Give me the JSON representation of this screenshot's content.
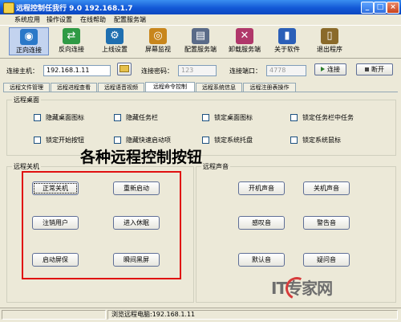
{
  "window": {
    "title": "远程控制任我行 9.0  192.168.1.7",
    "buttons": [
      "_",
      "□",
      "×"
    ]
  },
  "menu": [
    "系统应用",
    "操作设置",
    "在线帮助",
    "配置服务端"
  ],
  "toolbar": [
    {
      "label": "正向连接",
      "icon": "globe-connect-icon",
      "color": "#2a78c8",
      "glyph": "◉",
      "active": true
    },
    {
      "label": "反向连接",
      "icon": "reverse-connect-icon",
      "color": "#2f9a45",
      "glyph": "⇄"
    },
    {
      "label": "上线设置",
      "icon": "settings-globe-icon",
      "color": "#1f6fb0",
      "glyph": "⚙"
    },
    {
      "label": "屏幕监视",
      "icon": "eye-monitor-icon",
      "color": "#c8861c",
      "glyph": "◎"
    },
    {
      "label": "配置服务端",
      "icon": "server-config-icon",
      "color": "#5a6b88",
      "glyph": "▤"
    },
    {
      "label": "卸载服务端",
      "icon": "uninstall-server-icon",
      "color": "#b0376a",
      "glyph": "✕"
    },
    {
      "label": "关于软件",
      "icon": "book-icon",
      "color": "#2b5fb8",
      "glyph": "▮"
    },
    {
      "label": "退出程序",
      "icon": "exit-door-icon",
      "color": "#8a6a2a",
      "glyph": "▯"
    }
  ],
  "connection": {
    "host_label": "连接主机：",
    "host_value": "192.168.1.11",
    "password_label": "连接密码：",
    "password_value": "123",
    "port_label": "连接端口：",
    "port_value": "4778",
    "connect_label": "连接",
    "disconnect_label": "断开"
  },
  "tabs": [
    "远程文件管理",
    "远程进程查看",
    "远程语音视频",
    "远程命令控制",
    "远程系统信息",
    "远程注册表操作"
  ],
  "active_tab": 3,
  "desktop_group": {
    "title": "远程桌面",
    "options": [
      "隐藏桌面图标",
      "隐藏任务栏",
      "锁定桌面图标",
      "锁定任务栏中任务",
      "锁定开始按钮",
      "隐藏快速启动项",
      "锁定系统托盘",
      "锁定系统鼠标"
    ]
  },
  "shutdown_group": {
    "title": "远程关机",
    "buttons": [
      "正常关机",
      "重新启动",
      "注销用户",
      "进入休眠",
      "启动屏保",
      "瞬间黑屏"
    ]
  },
  "sound_group": {
    "title": "远程声音",
    "buttons": [
      "开机声音",
      "关机声音",
      "感叹音",
      "警告音",
      "默认音",
      "疑问音"
    ]
  },
  "annotation": "各种远程控制按钮",
  "watermark": "IT专家网",
  "status": {
    "text": "浏览远程电脑:192.168.1.11"
  },
  "colors": {
    "highlight": "#e01010",
    "titlebar": "#1358d6"
  }
}
